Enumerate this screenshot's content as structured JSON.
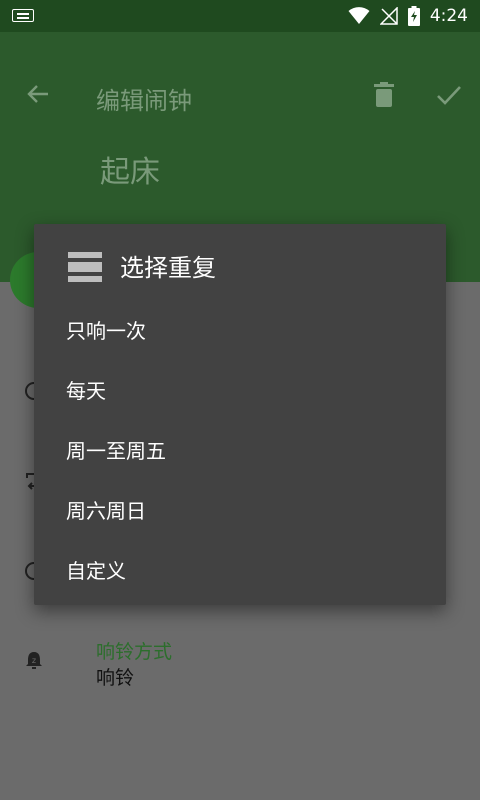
{
  "status_bar": {
    "time": "4:24"
  },
  "app_bar": {
    "title": "编辑闹钟",
    "alarm_name": "起床",
    "icons": [
      "back-arrow-icon",
      "trash-icon",
      "check-icon"
    ]
  },
  "settings": {
    "ring_mode": {
      "title": "响铃方式",
      "value": "响铃"
    }
  },
  "dialog": {
    "title": "选择重复",
    "options": [
      {
        "label": "只响一次"
      },
      {
        "label": "每天"
      },
      {
        "label": "周一至周五"
      },
      {
        "label": "周六周日"
      },
      {
        "label": "自定义"
      }
    ]
  },
  "colors": {
    "app_bar": "#2c5a2c",
    "status_bar": "#1f4a1f",
    "dialog_bg": "#424242",
    "scrim": "#6b6b6b",
    "accent": "#2c6e2c"
  }
}
